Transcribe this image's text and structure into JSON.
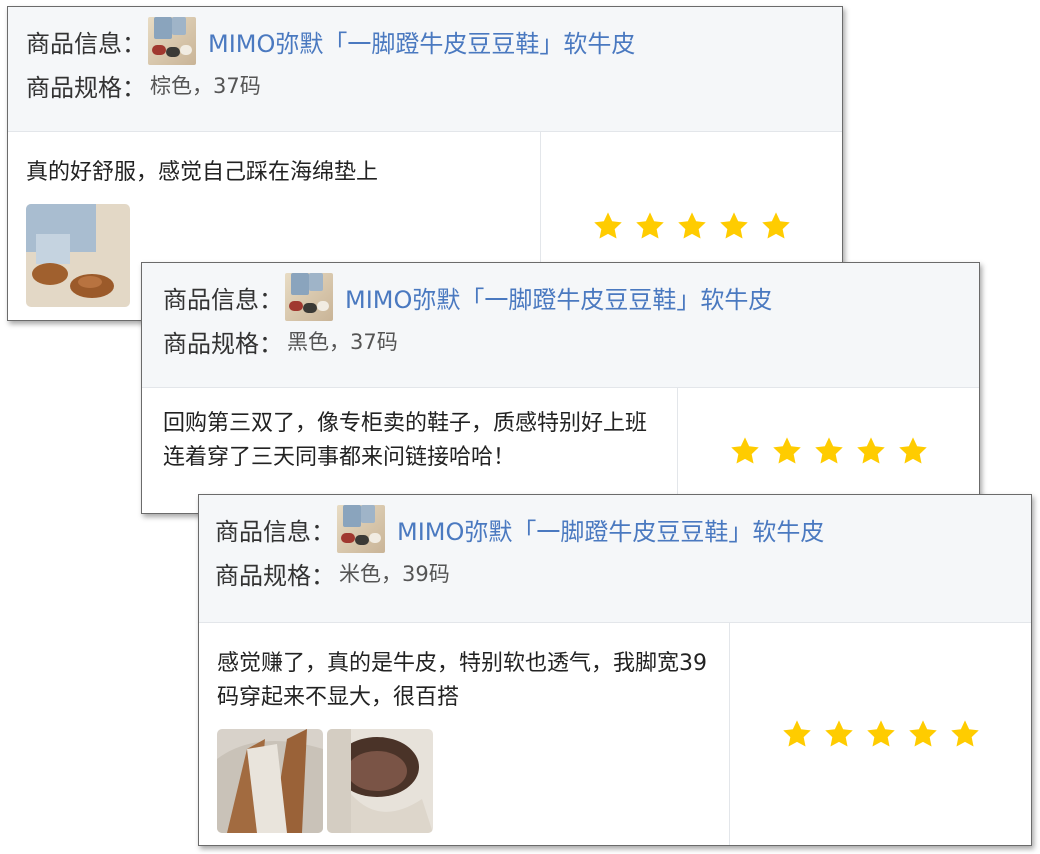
{
  "colors": {
    "link": "#4a79c0",
    "star": "#ffcc00",
    "header_bg": "#f5f7f9"
  },
  "reviews": [
    {
      "info_label": "商品信息：",
      "spec_label": "商品规格：",
      "product_title": "MIMO弥默「一脚蹬牛皮豆豆鞋」软牛皮",
      "spec": "棕色，37码",
      "text": "真的好舒服，感觉自己踩在海绵垫上",
      "rating": 5,
      "photos": [
        "brown-shoe-photo"
      ]
    },
    {
      "info_label": "商品信息：",
      "spec_label": "商品规格：",
      "product_title": "MIMO弥默「一脚蹬牛皮豆豆鞋」软牛皮",
      "spec": "黑色，37码",
      "text": "回购第三双了，像专柜卖的鞋子，质感特别好上班连着穿了三天同事都来问链接哈哈！",
      "rating": 5,
      "photos": []
    },
    {
      "info_label": "商品信息：",
      "spec_label": "商品规格：",
      "product_title": "MIMO弥默「一脚蹬牛皮豆豆鞋」软牛皮",
      "spec": "米色，39码",
      "text": "感觉赚了，真的是牛皮，特别软也透气，我脚宽39码穿起来不显大，很百搭",
      "rating": 5,
      "photos": [
        "beige-shoe-side-photo",
        "beige-shoe-back-photo"
      ]
    }
  ]
}
